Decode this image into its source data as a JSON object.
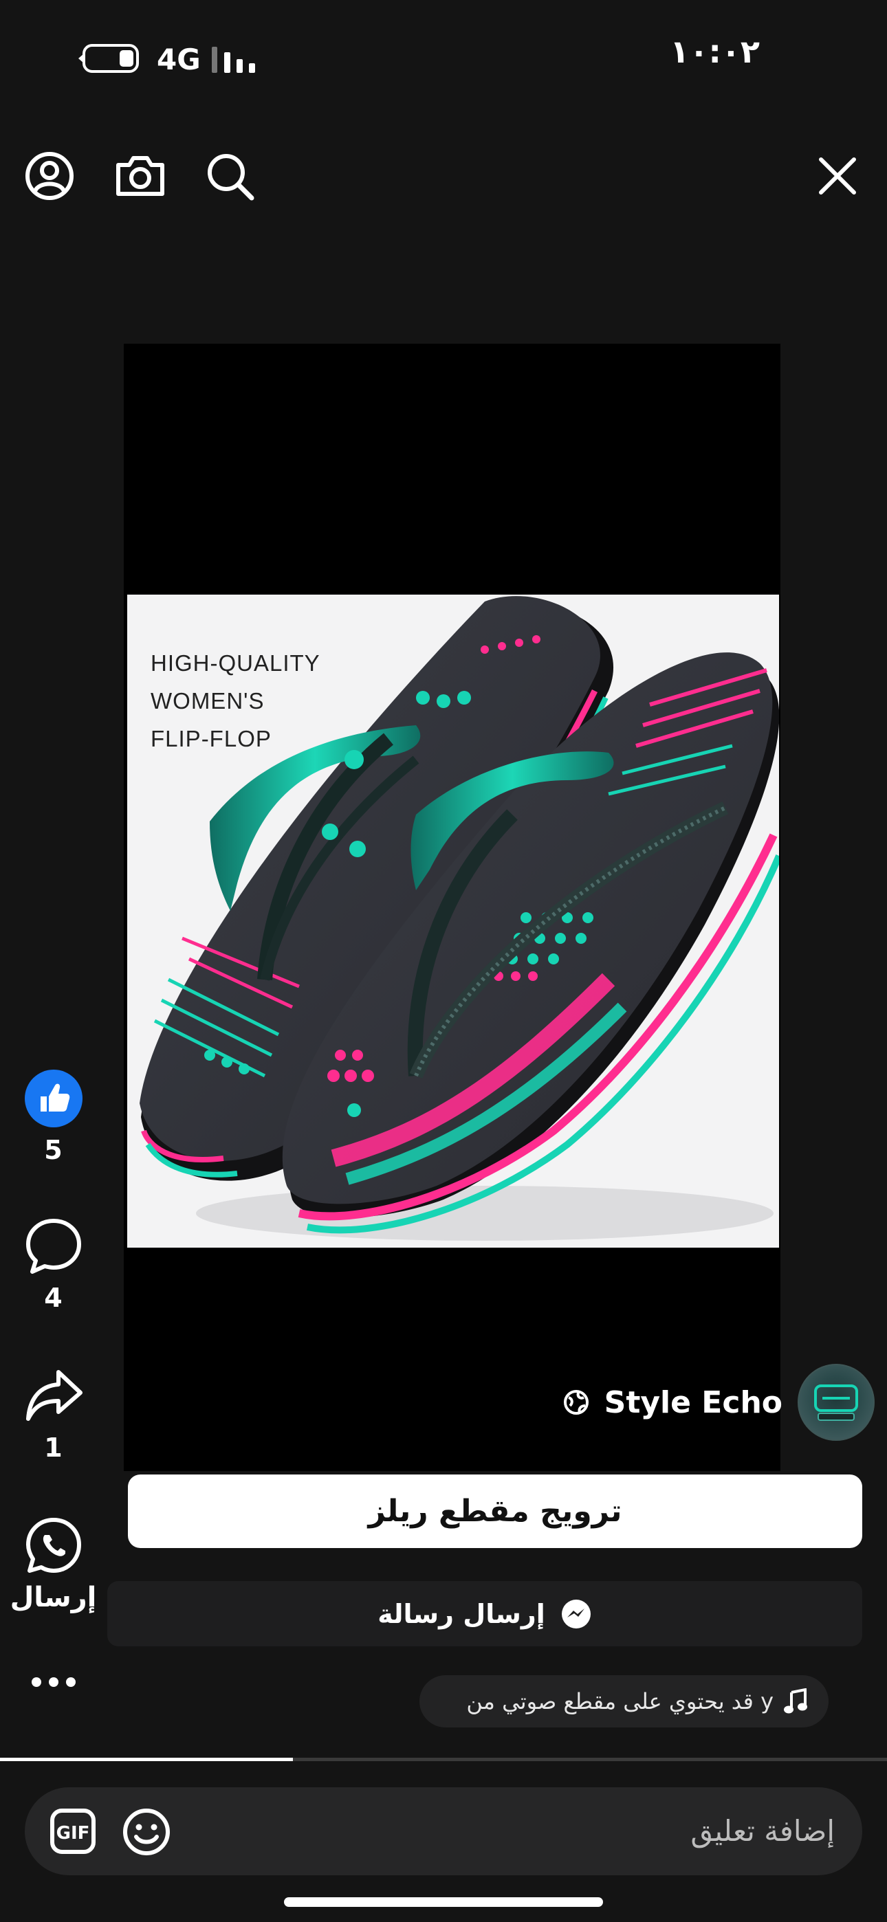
{
  "status_bar": {
    "time": "١٠:٠٢",
    "network": "4G"
  },
  "top_bar": {
    "icons": [
      "profile-icon",
      "camera-icon",
      "search-icon",
      "close-icon"
    ]
  },
  "post": {
    "image_caption": [
      "HIGH-QUALITY",
      "WOMEN'S",
      "FLIP-FLOP"
    ],
    "author": "Style Echo",
    "visibility_icon": "globe-icon"
  },
  "actions": {
    "like_count": "5",
    "comment_count": "4",
    "share_count": "1",
    "send_label": "إرسال"
  },
  "buttons": {
    "promote_label": "ترويج مقطع ريلز",
    "message_label": "إرسال رسالة"
  },
  "audio": {
    "text": "قد يحتوي على مقطع صوتي من y"
  },
  "playback": {
    "progress_percent": 33
  },
  "comment": {
    "placeholder": "إضافة تعليق"
  },
  "colors": {
    "like_blue": "#1877f2",
    "background": "#141414",
    "teal": "#17d4b4",
    "pink": "#ff2d8f"
  }
}
